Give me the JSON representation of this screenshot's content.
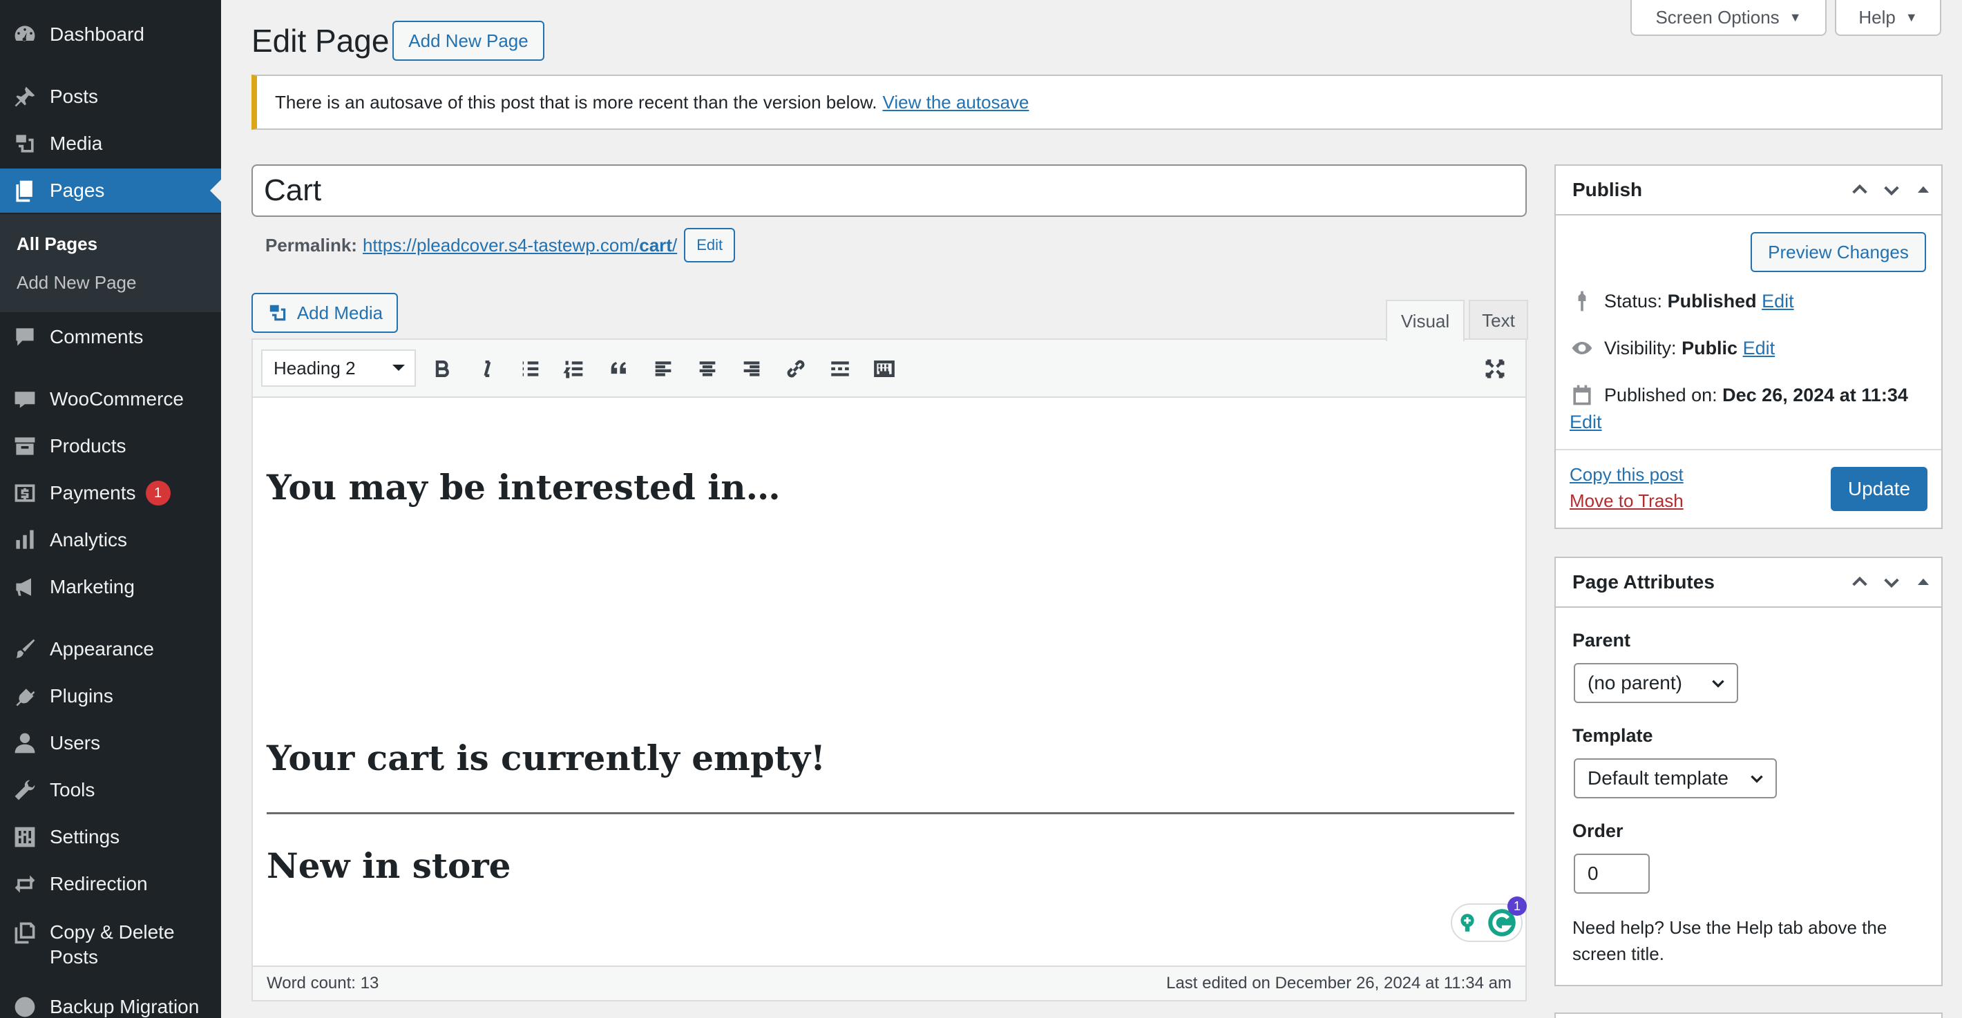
{
  "sidebar": {
    "items": [
      {
        "label": "Dashboard",
        "icon": "dashboard-icon"
      },
      {
        "label": "Posts",
        "icon": "pin-icon"
      },
      {
        "label": "Media",
        "icon": "media-icon"
      },
      {
        "label": "Pages",
        "icon": "pages-icon"
      },
      {
        "label": "Comments",
        "icon": "comment-icon"
      },
      {
        "label": "WooCommerce",
        "icon": "woo-icon"
      },
      {
        "label": "Products",
        "icon": "archive-icon"
      },
      {
        "label": "Payments",
        "icon": "dollar-icon",
        "badge": "1"
      },
      {
        "label": "Analytics",
        "icon": "bar-chart-icon"
      },
      {
        "label": "Marketing",
        "icon": "megaphone-icon"
      },
      {
        "label": "Appearance",
        "icon": "brush-icon"
      },
      {
        "label": "Plugins",
        "icon": "plug-icon"
      },
      {
        "label": "Users",
        "icon": "user-icon"
      },
      {
        "label": "Tools",
        "icon": "wrench-icon"
      },
      {
        "label": "Settings",
        "icon": "sliders-icon"
      },
      {
        "label": "Redirection",
        "icon": "redirect-icon"
      },
      {
        "label": "Copy & Delete",
        "label2": "Posts",
        "icon": "copy-icon"
      },
      {
        "label": "Backup Migration",
        "icon": "backup-icon"
      }
    ],
    "submenu": {
      "all_pages": "All Pages",
      "add_new": "Add New Page"
    }
  },
  "header": {
    "title": "Edit Page",
    "add_new": "Add New Page",
    "screen_options": "Screen Options",
    "help": "Help"
  },
  "notice": {
    "text": "There is an autosave of this post that is more recent than the version below.",
    "link": "View the autosave"
  },
  "post": {
    "title": "Cart",
    "permalink_label": "Permalink:",
    "permalink_base": "https://pleadcover.s4-tastewp.com/",
    "permalink_slug": "cart",
    "permalink_end": "/",
    "permalink_edit": "Edit"
  },
  "editor": {
    "add_media": "Add Media",
    "tab_visual": "Visual",
    "tab_text": "Text",
    "format": "Heading 2",
    "headings": [
      "You may be interested in…",
      "Your cart is currently empty!",
      "New in store"
    ],
    "word_count": "Word count: 13",
    "last_edited": "Last edited on December 26, 2024 at 11:34 am",
    "grammarly_count": "1"
  },
  "publish": {
    "title": "Publish",
    "preview": "Preview Changes",
    "status_label": "Status:",
    "status_value": "Published",
    "visibility_label": "Visibility:",
    "visibility_value": "Public",
    "published_label": "Published on:",
    "published_value": "Dec 26, 2024 at 11:34",
    "edit": "Edit",
    "copy": "Copy this post",
    "trash": "Move to Trash",
    "update": "Update"
  },
  "attributes": {
    "title": "Page Attributes",
    "parent_label": "Parent",
    "parent_value": "(no parent)",
    "template_label": "Template",
    "template_value": "Default template",
    "order_label": "Order",
    "order_value": "0",
    "help": "Need help? Use the Help tab above the screen title."
  },
  "colors": {
    "accent": "#2271b1",
    "sidebar": "#1d2327",
    "notice": "#dba617",
    "badge": "#d63638"
  }
}
